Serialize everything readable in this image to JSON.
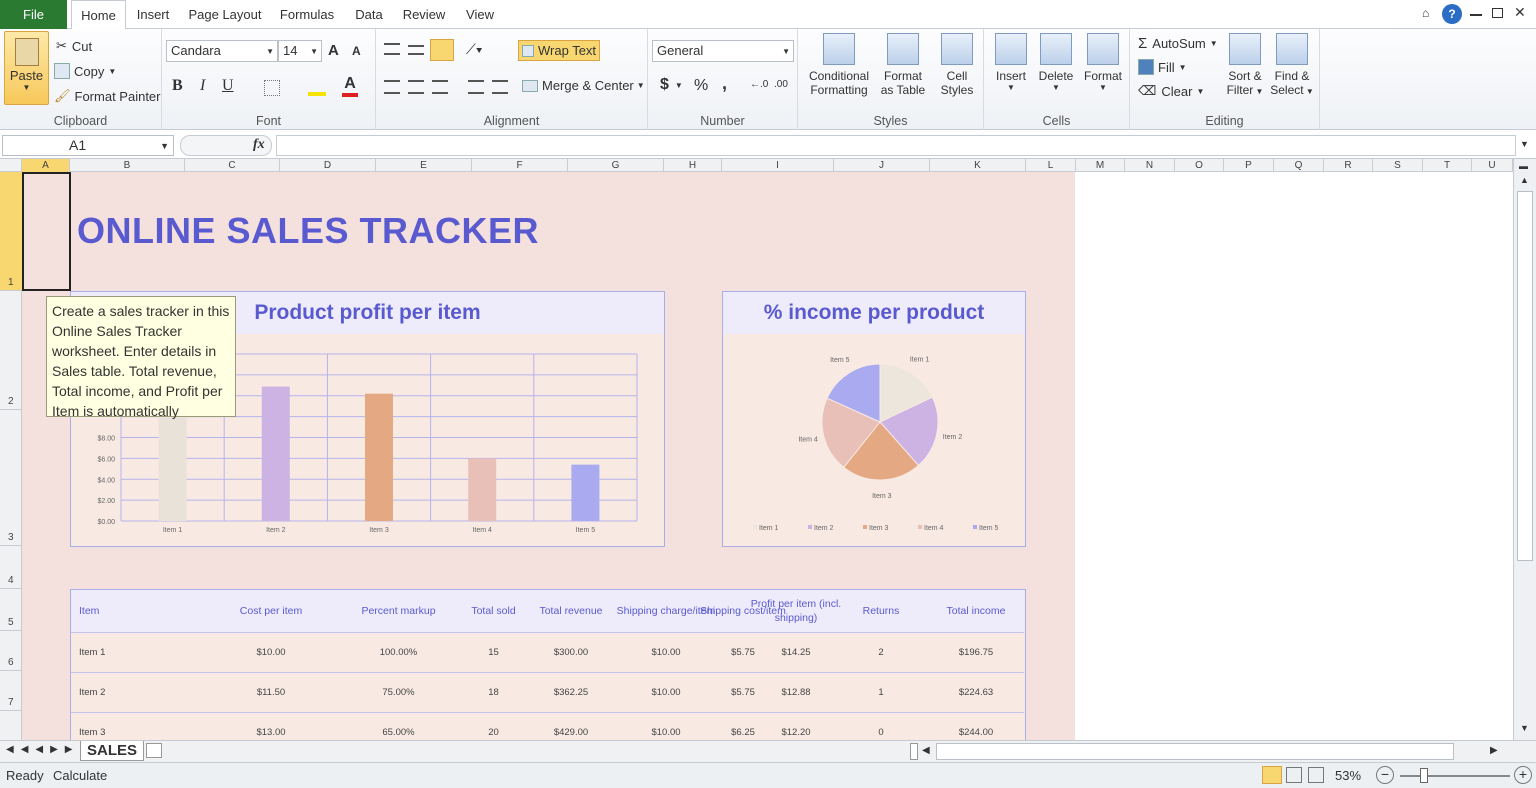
{
  "tabs": {
    "file": "File",
    "home": "Home",
    "insert": "Insert",
    "page_layout": "Page Layout",
    "formulas": "Formulas",
    "data": "Data",
    "review": "Review",
    "view": "View"
  },
  "clipboard": {
    "paste": "Paste",
    "cut": "Cut",
    "copy": "Copy",
    "format_painter": "Format Painter",
    "label": "Clipboard"
  },
  "font": {
    "name": "Candara",
    "size": "14",
    "bold": "B",
    "italic": "I",
    "underline": "U",
    "grow": "A",
    "shrink": "A",
    "label": "Font"
  },
  "alignment": {
    "wrap": "Wrap Text",
    "merge": "Merge & Center",
    "label": "Alignment"
  },
  "number": {
    "format": "General",
    "currency": "$",
    "percent": "%",
    "comma": ",",
    "label": "Number"
  },
  "styles": {
    "cond1": "Conditional",
    "cond2": "Formatting",
    "fmt1": "Format",
    "fmt2": "as Table",
    "cell1": "Cell",
    "cell2": "Styles",
    "label": "Styles"
  },
  "cells": {
    "insert": "Insert",
    "delete": "Delete",
    "format": "Format",
    "label": "Cells"
  },
  "editing": {
    "autosum": "AutoSum",
    "fill": "Fill",
    "clear": "Clear",
    "sort1": "Sort &",
    "sort2": "Filter",
    "find1": "Find &",
    "find2": "Select",
    "label": "Editing"
  },
  "formula_bar": {
    "cell_ref": "A1",
    "fx": "fx",
    "value": ""
  },
  "columns": [
    "A",
    "B",
    "C",
    "D",
    "E",
    "F",
    "G",
    "H",
    "I",
    "J",
    "K",
    "L",
    "M",
    "N",
    "O",
    "P",
    "Q",
    "R",
    "S",
    "T",
    "U"
  ],
  "rows": [
    "1",
    "2",
    "3",
    "4",
    "5",
    "6",
    "7"
  ],
  "sheet_title": "ONLINE SALES TRACKER",
  "tooltip": "Create a sales tracker in this Online Sales Tracker worksheet. Enter details in Sales table. Total revenue, Total income, and Profit per Item is automatically",
  "chart_data": [
    {
      "type": "bar",
      "title": "Product profit per item",
      "categories": [
        "Item 1",
        "Item 2",
        "Item 3",
        "Item 4",
        "Item 5"
      ],
      "values": [
        14.25,
        12.88,
        12.2,
        6.0,
        5.4
      ],
      "ytick_labels": [
        "$0.00",
        "$2.00",
        "$4.00",
        "$6.00",
        "$8.00"
      ],
      "ylim": [
        0,
        16
      ],
      "colors": [
        "#e8e2d8",
        "#cdb3e4",
        "#e4a882",
        "#e8c0b8",
        "#a9aaf0"
      ]
    },
    {
      "type": "pie",
      "title": "% income per product",
      "categories": [
        "Item 1",
        "Item 2",
        "Item 3",
        "Item 4",
        "Item 5"
      ],
      "values": [
        196.75,
        224.63,
        244.0,
        230.0,
        200.0
      ],
      "colors": [
        "#ece6dc",
        "#cdb3e4",
        "#e4a882",
        "#e8c0b8",
        "#a9aaf0"
      ],
      "legend": "bottom"
    }
  ],
  "table": {
    "headers": [
      "Item",
      "Cost per item",
      "Percent markup",
      "Total sold",
      "Total revenue",
      "Shipping charge/item",
      "Shipping cost/item",
      "Profit per item (incl. shipping)",
      "Returns",
      "Total income"
    ],
    "rows": [
      [
        "Item 1",
        "$10.00",
        "100.00%",
        "15",
        "$300.00",
        "$10.00",
        "$5.75",
        "$14.25",
        "2",
        "$196.75"
      ],
      [
        "Item 2",
        "$11.50",
        "75.00%",
        "18",
        "$362.25",
        "$10.00",
        "$5.75",
        "$12.88",
        "1",
        "$224.63"
      ],
      [
        "Item 3",
        "$13.00",
        "65.00%",
        "20",
        "$429.00",
        "$10.00",
        "$6.25",
        "$12.20",
        "0",
        "$244.00"
      ]
    ]
  },
  "sheet_tab": "SALES",
  "status": {
    "ready": "Ready",
    "calculate": "Calculate",
    "zoom": "53%"
  }
}
